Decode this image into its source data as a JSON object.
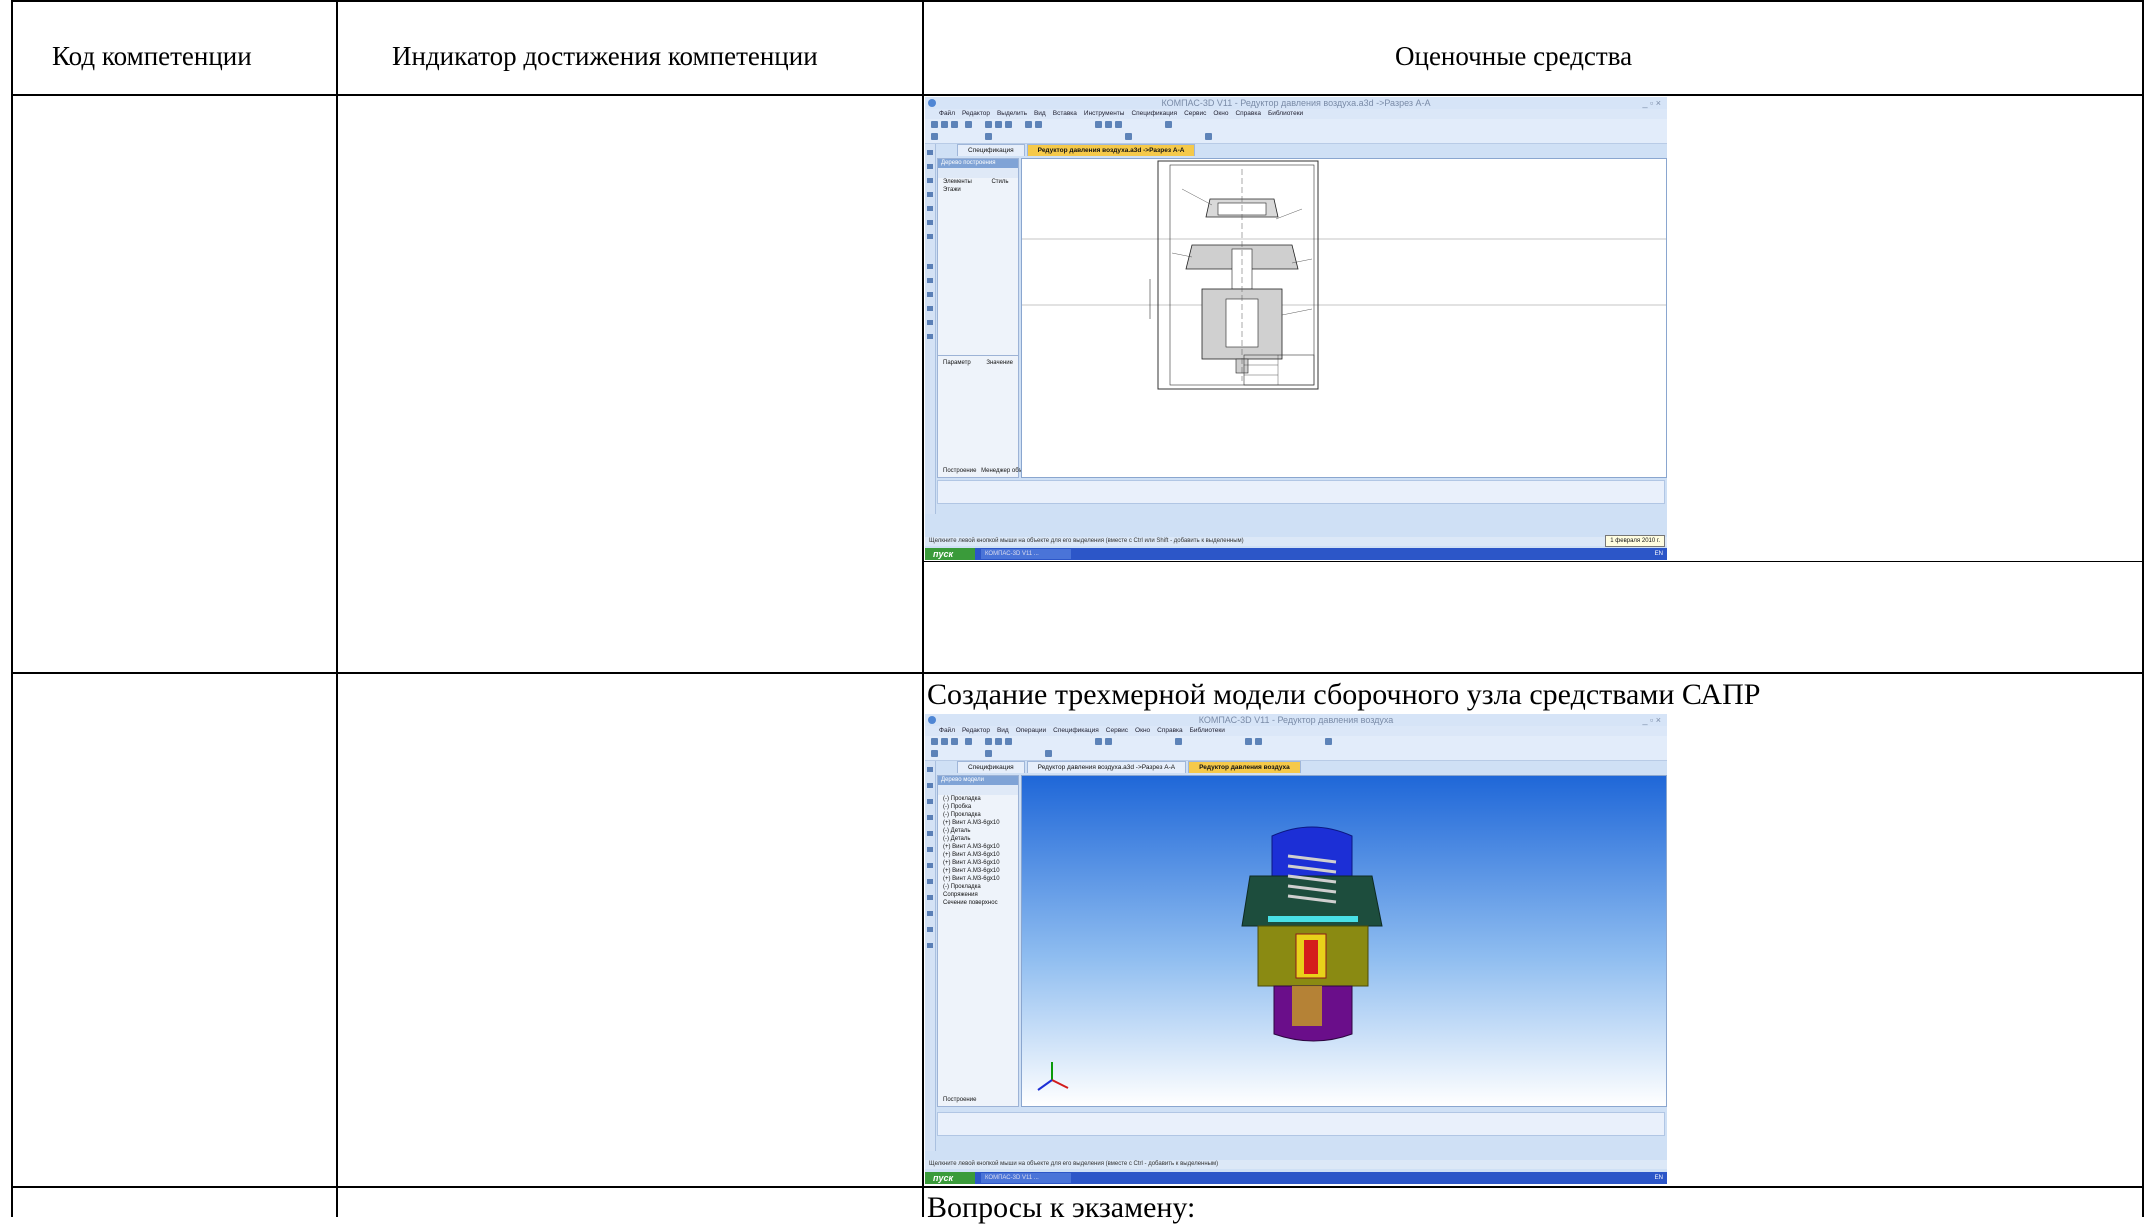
{
  "table": {
    "headers": {
      "code": "Код компетенции",
      "indicator": "Индикатор достижения компетенции",
      "assessment": "Оценочные средства"
    },
    "rows": [
      {
        "code": "",
        "indicator": "",
        "assessment_caption": ""
      },
      {
        "code": "",
        "indicator": "",
        "assessment_caption": "Создание трехмерной модели сборочного узла средствами САПР"
      },
      {
        "code": "",
        "indicator": "",
        "assessment_caption": "Вопросы к экзамену:"
      }
    ]
  },
  "screenshot1": {
    "title": "КОМПАС-3D V11 - Редуктор давления воздуха.a3d ->Разрез А-А",
    "menu": [
      "Файл",
      "Редактор",
      "Выделить",
      "Вид",
      "Вставка",
      "Инструменты",
      "Спецификация",
      "Сервис",
      "Окно",
      "Справка",
      "Библиотеки"
    ],
    "tabs": [
      "Спецификация",
      "Редуктор давления воздуха.a3d ->Разрез А-А"
    ],
    "tree_title": "Дерево построения",
    "tree_cols": [
      "Элементы",
      "Стиль"
    ],
    "tree_item": "Этажи",
    "param_cols": [
      "Параметр",
      "Значение"
    ],
    "bottom_tabs": [
      "Построение",
      "Менеджер объе..."
    ],
    "status": "Щелкните левой кнопкой мыши на объекте для его выделения (вместе с Ctrl или Shift - добавить к выделенным)",
    "date_badge": "1 февраля 2010 г.",
    "start": "пуск",
    "taskbar_item": "КОМПАС-3D V11 ...",
    "tray": "EN"
  },
  "screenshot2": {
    "title": "КОМПАС-3D V11 - Редуктор давления воздуха",
    "menu": [
      "Файл",
      "Редактор",
      "Вид",
      "Операции",
      "Спецификация",
      "Сервис",
      "Окно",
      "Справка",
      "Библиотеки"
    ],
    "tabs": [
      "Спецификация",
      "Редуктор давления воздуха.a3d ->Разрез А-А",
      "Редуктор давления воздуха"
    ],
    "tree_title": "Дерево модели",
    "tree_items": [
      "(-) Прокладка",
      "(-) Пробка",
      "(-) Прокладка",
      "(+) Винт А.М3-6gx10",
      "(-) Деталь",
      "(-) Деталь",
      "(+) Винт А.М3-6gx10",
      "(+) Винт А.М3-6gx10",
      "(+) Винт А.М3-6gx10",
      "(+) Винт А.М3-6gx10",
      "(+) Винт А.М3-6gx10",
      "(-) Прокладка",
      "Сопряжения",
      "Сечение поверхнос"
    ],
    "bottom_tab": "Построение",
    "status": "Щелкните левой кнопкой мыши на объекте для его выделения (вместе с Ctrl - добавить к выделенным)",
    "start": "пуск",
    "taskbar_item": "КОМПАС-3D V11 ...",
    "tray": "EN"
  }
}
